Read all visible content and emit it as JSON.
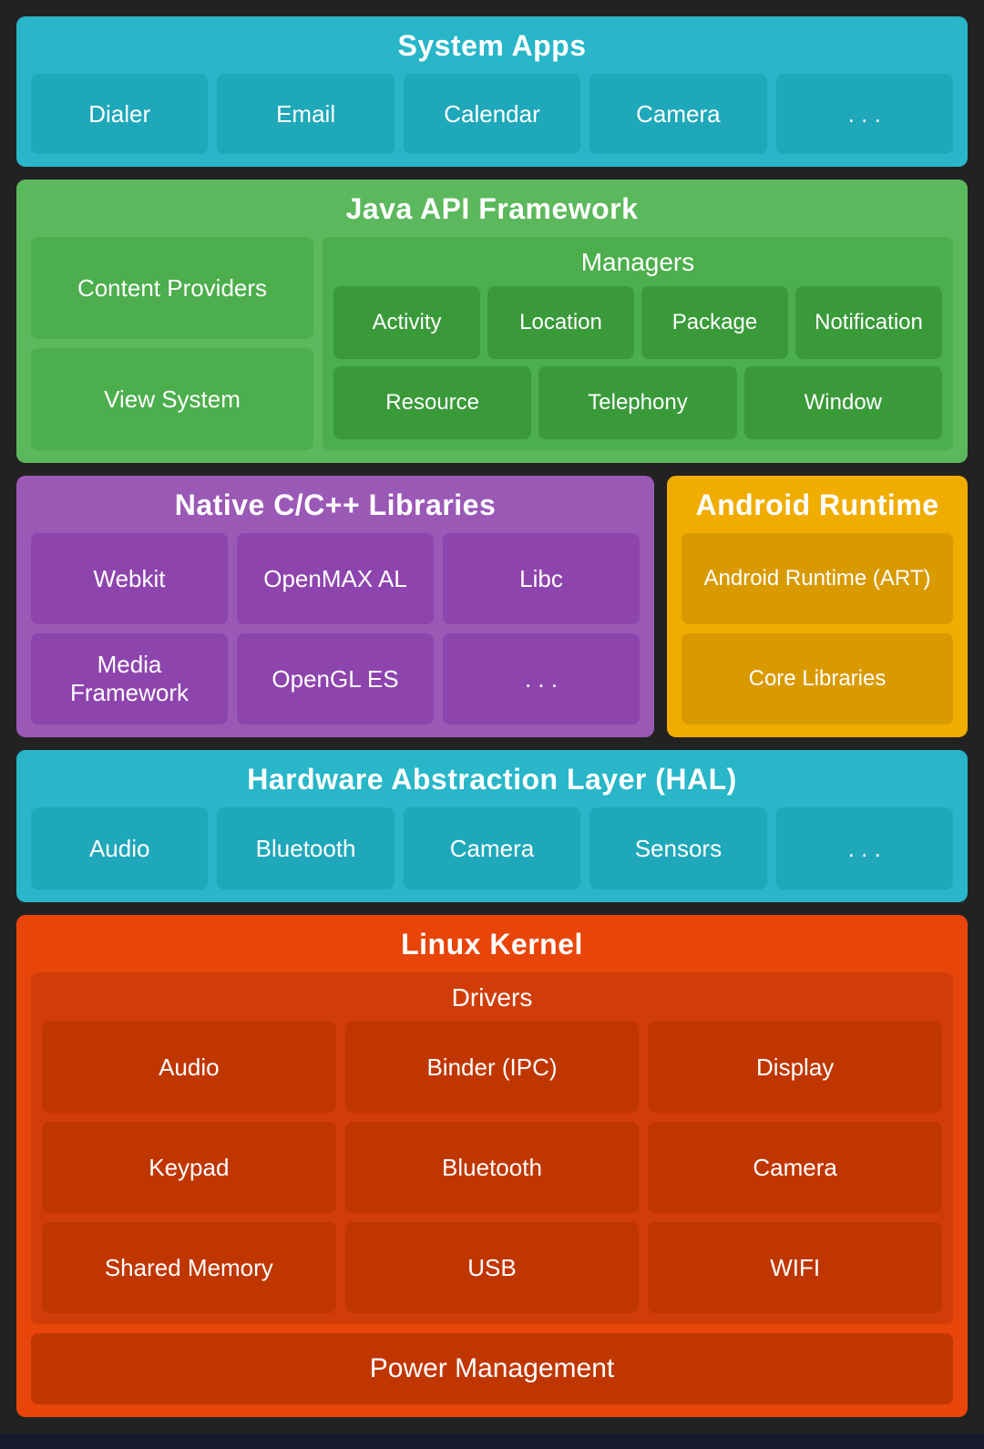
{
  "systemApps": {
    "title": "System Apps",
    "cells": [
      "Dialer",
      "Email",
      "Calendar",
      "Camera",
      ". . ."
    ]
  },
  "javaFramework": {
    "title": "Java API Framework",
    "leftCells": [
      "Content Providers",
      "View System"
    ],
    "managers": {
      "title": "Managers",
      "row1": [
        "Activity",
        "Location",
        "Package",
        "Notification"
      ],
      "row2": [
        "Resource",
        "Telephony",
        "Window"
      ]
    }
  },
  "nativeLibs": {
    "title": "Native C/C++ Libraries",
    "cells": [
      "Webkit",
      "OpenMAX AL",
      "Libc",
      "Media Framework",
      "OpenGL ES",
      ". . ."
    ]
  },
  "androidRuntime": {
    "title": "Android Runtime",
    "cells": [
      "Android Runtime (ART)",
      "Core Libraries"
    ]
  },
  "hal": {
    "title": "Hardware Abstraction Layer (HAL)",
    "cells": [
      "Audio",
      "Bluetooth",
      "Camera",
      "Sensors",
      ". . ."
    ]
  },
  "linuxKernel": {
    "title": "Linux Kernel",
    "driversTitle": "Drivers",
    "drivers": [
      "Audio",
      "Binder (IPC)",
      "Display",
      "Keypad",
      "Bluetooth",
      "Camera",
      "Shared Memory",
      "USB",
      "WIFI"
    ],
    "powerManagement": "Power Management"
  }
}
